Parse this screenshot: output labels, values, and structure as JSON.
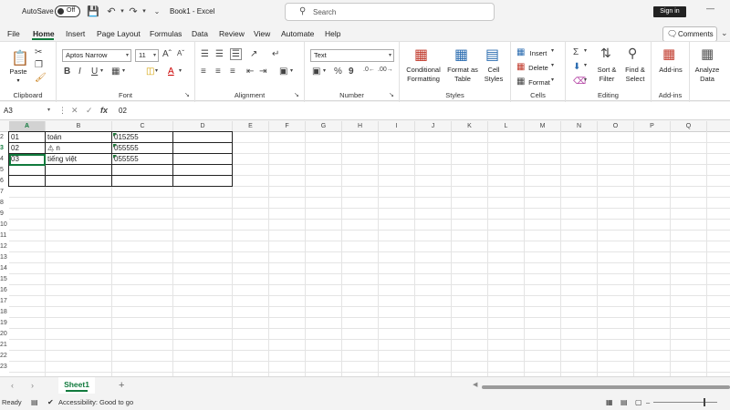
{
  "titlebar": {
    "autosave_label": "AutoSave",
    "autosave_state": "Off",
    "document_title": "Book1 - Excel",
    "search_placeholder": "Search",
    "signin_label": "Sign in"
  },
  "menu": {
    "tabs": [
      "File",
      "Home",
      "Insert",
      "Page Layout",
      "Formulas",
      "Data",
      "Review",
      "View",
      "Automate",
      "Help"
    ],
    "active": "Home",
    "comments_label": "Comments"
  },
  "ribbon": {
    "clipboard": {
      "paste_label": "Paste",
      "group_label": "Clipboard"
    },
    "font": {
      "font_name": "Aptos Narrow",
      "font_size": "11",
      "group_label": "Font"
    },
    "alignment": {
      "group_label": "Alignment"
    },
    "number": {
      "format": "Text",
      "group_label": "Number"
    },
    "styles": {
      "conditional_formatting": [
        "Conditional",
        "Formatting"
      ],
      "format_as_table": [
        "Format as",
        "Table"
      ],
      "cell_styles": [
        "Cell",
        "Styles"
      ],
      "group_label": "Styles"
    },
    "cells": {
      "insert": "Insert",
      "delete": "Delete",
      "format": "Format",
      "group_label": "Cells"
    },
    "editing": {
      "sort_filter": [
        "Sort &",
        "Filter"
      ],
      "find_select": [
        "Find &",
        "Select"
      ],
      "group_label": "Editing"
    },
    "addins": {
      "addins_label": "Add-ins",
      "group_label": "Add-ins"
    },
    "analyze": {
      "label": [
        "Analyze",
        "Data"
      ]
    }
  },
  "formula_bar": {
    "name_box": "A3",
    "content": "02"
  },
  "grid": {
    "columns": [
      "A",
      "B",
      "C",
      "D",
      "E",
      "F",
      "G",
      "H",
      "I",
      "J",
      "K",
      "L",
      "M",
      "N",
      "O",
      "P",
      "Q"
    ],
    "selected_column": "A",
    "rows": [
      "2",
      "3",
      "4",
      "5",
      "6",
      "7",
      "8",
      "9",
      "10",
      "11",
      "12",
      "13",
      "14",
      "15",
      "16",
      "17",
      "18",
      "19",
      "20",
      "21",
      "22",
      "23"
    ],
    "selected_row": "3",
    "cells": [
      [
        "01",
        "toán",
        "015255"
      ],
      [
        "02",
        "⚠̣ n",
        "055555"
      ],
      [
        "03",
        "tiếng việt",
        "055555"
      ]
    ]
  },
  "sheets": {
    "tabs": [
      "Sheet1"
    ],
    "active": "Sheet1"
  },
  "status": {
    "ready": "Ready",
    "accessibility": "Accessibility: Good to go"
  },
  "colors": {
    "accent": "#117a3d",
    "ribbon_bg": "#ffffff",
    "chrome_bg": "#f3f3f3"
  }
}
